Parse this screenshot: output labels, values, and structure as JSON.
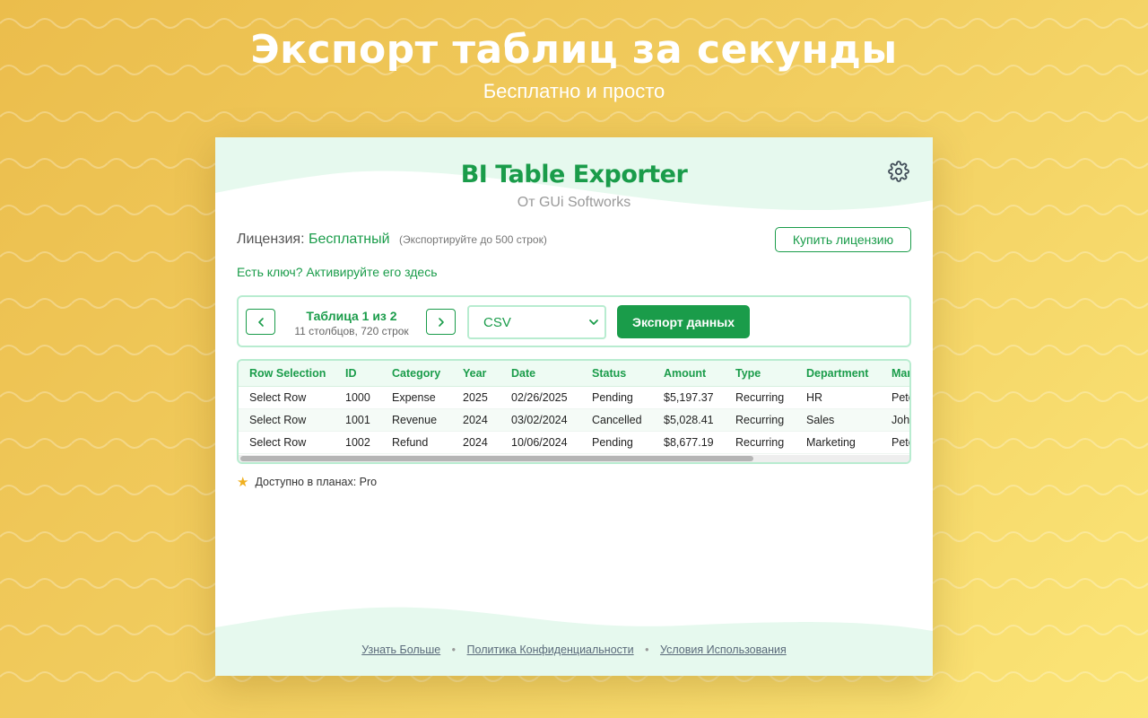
{
  "hero": {
    "title": "Экспорт таблиц за секунды",
    "subtitle": "Бесплатно и просто"
  },
  "app": {
    "title": "BI Table Exporter",
    "subtitle": "От GUi Softworks",
    "settings_icon": "gear-icon"
  },
  "license": {
    "label": "Лицензия:",
    "value": "Бесплатный",
    "note": "(Экспортируйте до 500 строк)",
    "buy_label": "Купить лицензию",
    "activate_link": "Есть ключ? Активируйте его здесь"
  },
  "toolbar": {
    "table_title": "Таблица 1 из 2",
    "table_meta": "11 столбцов, 720 строк",
    "format_selected": "CSV",
    "export_label": "Экспорт данных"
  },
  "table": {
    "columns": [
      "Row Selection",
      "ID",
      "Category",
      "Year",
      "Date",
      "Status",
      "Amount",
      "Type",
      "Department",
      "Man"
    ],
    "rows": [
      [
        "Select Row",
        "1000",
        "Expense",
        "2025",
        "02/26/2025",
        "Pending",
        "$5,197.37",
        "Recurring",
        "HR",
        "Pete"
      ],
      [
        "Select Row",
        "1001",
        "Revenue",
        "2024",
        "03/02/2024",
        "Cancelled",
        "$5,028.41",
        "Recurring",
        "Sales",
        "John"
      ],
      [
        "Select Row",
        "1002",
        "Refund",
        "2024",
        "10/06/2024",
        "Pending",
        "$8,677.19",
        "Recurring",
        "Marketing",
        "Pete"
      ]
    ]
  },
  "plan_note": {
    "icon": "star-icon",
    "text": "Доступно в планах: Pro"
  },
  "footer": {
    "learn_more": "Узнать Больше",
    "privacy": "Политика Конфиденциальности",
    "terms": "Условия Использования",
    "separator": "•"
  },
  "colors": {
    "accent": "#1a9c4a",
    "background": "#f1cc5e",
    "panel": "#ffffff"
  }
}
